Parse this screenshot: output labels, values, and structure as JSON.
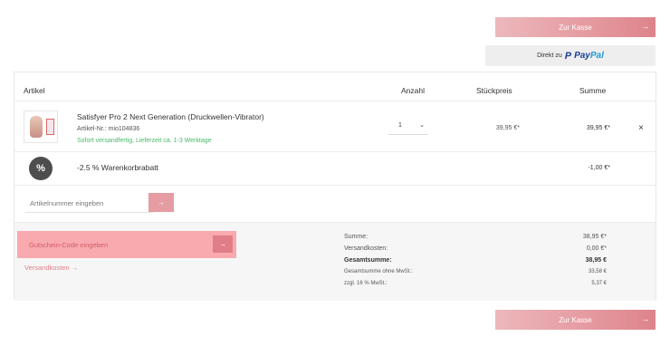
{
  "checkout": {
    "label": "Zur Kasse",
    "arrow": "→"
  },
  "paypal": {
    "prefix": "Direkt zu",
    "pay": "Pay",
    "pal": "Pal"
  },
  "cart": {
    "headers": {
      "article": "Artikel",
      "quantity": "Anzahl",
      "unit_price": "Stückpreis",
      "total": "Summe"
    },
    "item": {
      "title": "Satisfyer Pro 2 Next Generation (Druckwellen-Vibrator)",
      "sku": "Artikel-Nr.: mio104836",
      "stock": "Sofort versandfertig, Lieferzeit ca. 1-3 Werktage",
      "quantity": "1",
      "unit_price": "39,95 €*",
      "line_total": "39,95 €*",
      "remove_icon": "close-icon"
    },
    "discount": {
      "badge": "%",
      "label": "-2.5 % Warenkorbrabatt",
      "amount": "-1,00 €*"
    },
    "article_add": {
      "placeholder": "Artikelnummer eingeben",
      "arrow": "→"
    }
  },
  "voucher": {
    "label": "Gutschein-Code eingeben",
    "arrow": "→"
  },
  "shipping_link": "Versandkosten",
  "summary": [
    {
      "label": "Summe:",
      "value": "38,95 €*"
    },
    {
      "label": "Versandkosten:",
      "value": "0,00 €*"
    },
    {
      "label": "Gesamtsumme:",
      "value": "38,95 €"
    },
    {
      "label": "Gesamtsumme ohne MwSt.:",
      "value": "33,58 €"
    },
    {
      "label": "zzgl. 16 % MwSt.:",
      "value": "5,37 €"
    }
  ],
  "colors": {
    "accent": "#e59ca2",
    "voucher_bg": "#f8aaaf",
    "stock": "#49b86a",
    "paypal_dark": "#1c3f94",
    "paypal_light": "#1d9ad8"
  }
}
